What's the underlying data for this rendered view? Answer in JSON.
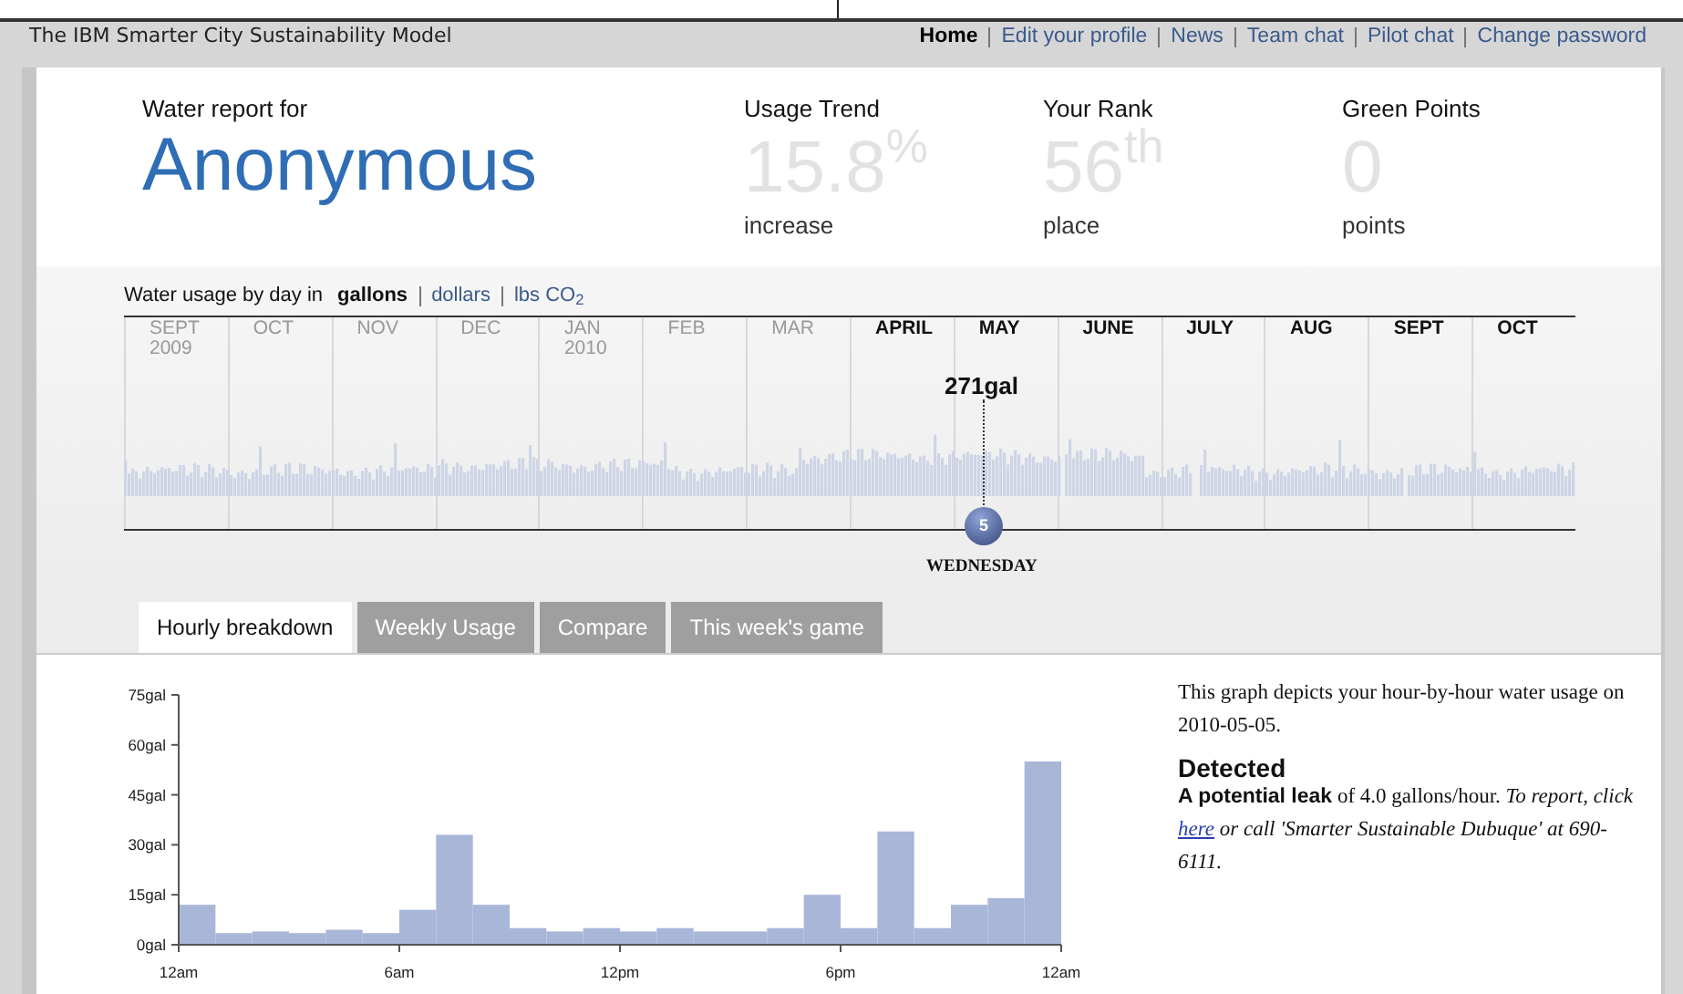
{
  "window": {
    "title": "The IBM Smarter City Sustainability Model"
  },
  "nav": [
    {
      "label": "Home",
      "selected": true
    },
    {
      "label": "Edit your profile",
      "selected": false
    },
    {
      "label": "News",
      "selected": false
    },
    {
      "label": "Team chat",
      "selected": false
    },
    {
      "label": "Pilot chat",
      "selected": false
    },
    {
      "label": "Change password",
      "selected": false
    }
  ],
  "report": {
    "caption": "Water report for",
    "user": "Anonymous"
  },
  "stats": [
    {
      "title": "Usage Trend",
      "value": "15.8$^{%}$",
      "unit": "increase"
    },
    {
      "title": "Your Rank",
      "value": "56$^{th}$",
      "unit": "place"
    },
    {
      "title": "Green Points",
      "value": "0",
      "unit": "points"
    }
  ],
  "usage": {
    "caption": "Water usage by day in",
    "units": [
      {
        "label": "gallons",
        "selected": true
      },
      {
        "label": "dollars",
        "selected": false
      },
      {
        "label": "lbs CO$_{2}$",
        "selected": false
      }
    ],
    "months": [
      {
        "label": "SEPT",
        "year": "2009",
        "dim": true
      },
      {
        "label": "OCT",
        "dim": true
      },
      {
        "label": "NOV",
        "dim": true
      },
      {
        "label": "DEC",
        "dim": true
      },
      {
        "label": "JAN",
        "year": "2010",
        "dim": true
      },
      {
        "label": "FEB",
        "dim": true
      },
      {
        "label": "MAR",
        "dim": true
      },
      {
        "label": "APRIL",
        "dim": false
      },
      {
        "label": "MAY",
        "dim": false
      },
      {
        "label": "JUNE",
        "dim": false
      },
      {
        "label": "JULY",
        "dim": false
      },
      {
        "label": "AUG",
        "dim": false
      },
      {
        "label": "SEPT",
        "dim": false
      },
      {
        "label": "OCT",
        "dim": false
      }
    ],
    "marker": {
      "reading": "271gal",
      "day": "5",
      "weekday": "WEDNESDAY"
    }
  },
  "tabs": [
    {
      "label": "Hourly breakdown",
      "selected": true
    },
    {
      "label": "Weekly Usage",
      "selected": false
    },
    {
      "label": "Compare",
      "selected": false
    },
    {
      "label": "This week's game",
      "selected": false
    }
  ],
  "hourly": {
    "chart_data": {
      "type": "bar",
      "ylim": [
        0,
        75
      ],
      "yticks": [
        {
          "value": 0,
          "label": "0gal"
        },
        {
          "value": 15,
          "label": "15gal"
        },
        {
          "value": 30,
          "label": "30gal"
        },
        {
          "value": 45,
          "label": "45gal"
        },
        {
          "value": 60,
          "label": "60gal"
        },
        {
          "value": 75,
          "label": "75gal"
        }
      ],
      "series": [
        {
          "color": "#a8b6d8",
          "values": [
            12,
            3.5,
            4,
            3.5,
            4.5,
            3.5,
            10.5,
            33,
            12,
            5,
            4,
            5,
            4,
            5,
            4,
            4,
            5,
            15,
            5,
            34,
            5,
            12,
            14,
            55
          ]
        }
      ]
    },
    "time_labels": [
      "12am",
      "6am",
      "12pm",
      "6pm",
      "12am"
    ]
  },
  "details": {
    "description": "This graph depicts your hour-by-hour water usage on 2010-05-05.",
    "heading": "Detected",
    "leak_before": "**A potential leak** of 4.0 gallons/hour. *To report, click*",
    "link": "here",
    "leak_after": "*or call 'Smarter Sustainable Dubuque' at 690-6111.*"
  }
}
